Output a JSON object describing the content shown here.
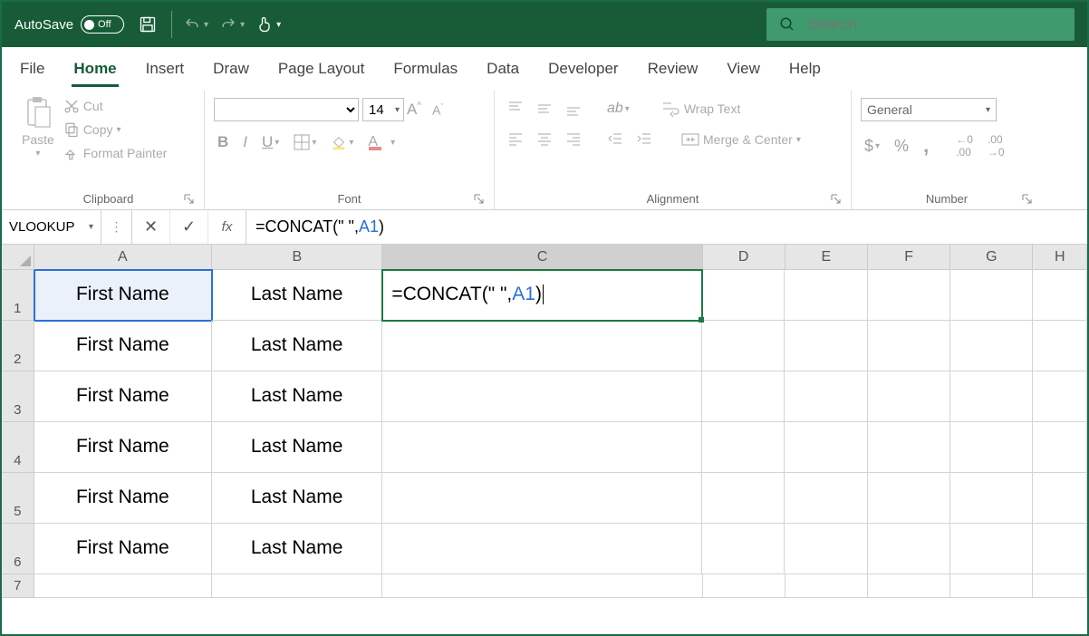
{
  "titlebar": {
    "autosave_label": "AutoSave",
    "autosave_state": "Off",
    "search_placeholder": "Search"
  },
  "tabs": [
    "File",
    "Home",
    "Insert",
    "Draw",
    "Page Layout",
    "Formulas",
    "Data",
    "Developer",
    "Review",
    "View",
    "Help"
  ],
  "active_tab": "Home",
  "ribbon": {
    "clipboard": {
      "paste": "Paste",
      "cut": "Cut",
      "copy": "Copy",
      "format_painter": "Format Painter",
      "label": "Clipboard"
    },
    "font": {
      "name": "",
      "size": "14",
      "label": "Font"
    },
    "alignment": {
      "wrap": "Wrap Text",
      "merge": "Merge & Center",
      "label": "Alignment"
    },
    "number": {
      "format": "General",
      "label": "Number"
    }
  },
  "formula_bar": {
    "name_box": "VLOOKUP",
    "formula_prefix": "=CONCAT(\"       \",",
    "formula_ref": "A1",
    "formula_suffix": ")"
  },
  "grid": {
    "columns": [
      "A",
      "B",
      "C",
      "D",
      "E",
      "F",
      "G",
      "H"
    ],
    "col_widths": {
      "A": 198,
      "B": 190,
      "C": 356,
      "D": 92,
      "E": 92,
      "F": 92,
      "G": 92,
      "H": 60
    },
    "rows": [
      {
        "n": 1,
        "A": "First Name",
        "B": "Last Name",
        "C_formula_prefix": "=CONCAT(\"        \",",
        "C_formula_ref": "A1",
        "C_formula_suffix": ")"
      },
      {
        "n": 2,
        "A": "First Name",
        "B": "Last Name"
      },
      {
        "n": 3,
        "A": "First Name",
        "B": "Last Name"
      },
      {
        "n": 4,
        "A": "First Name",
        "B": "Last Name"
      },
      {
        "n": 5,
        "A": "First Name",
        "B": "Last Name"
      },
      {
        "n": 6,
        "A": "First Name",
        "B": "Last Name"
      },
      {
        "n": 7
      }
    ],
    "selected_cell": "C1",
    "referenced_cell": "A1"
  }
}
